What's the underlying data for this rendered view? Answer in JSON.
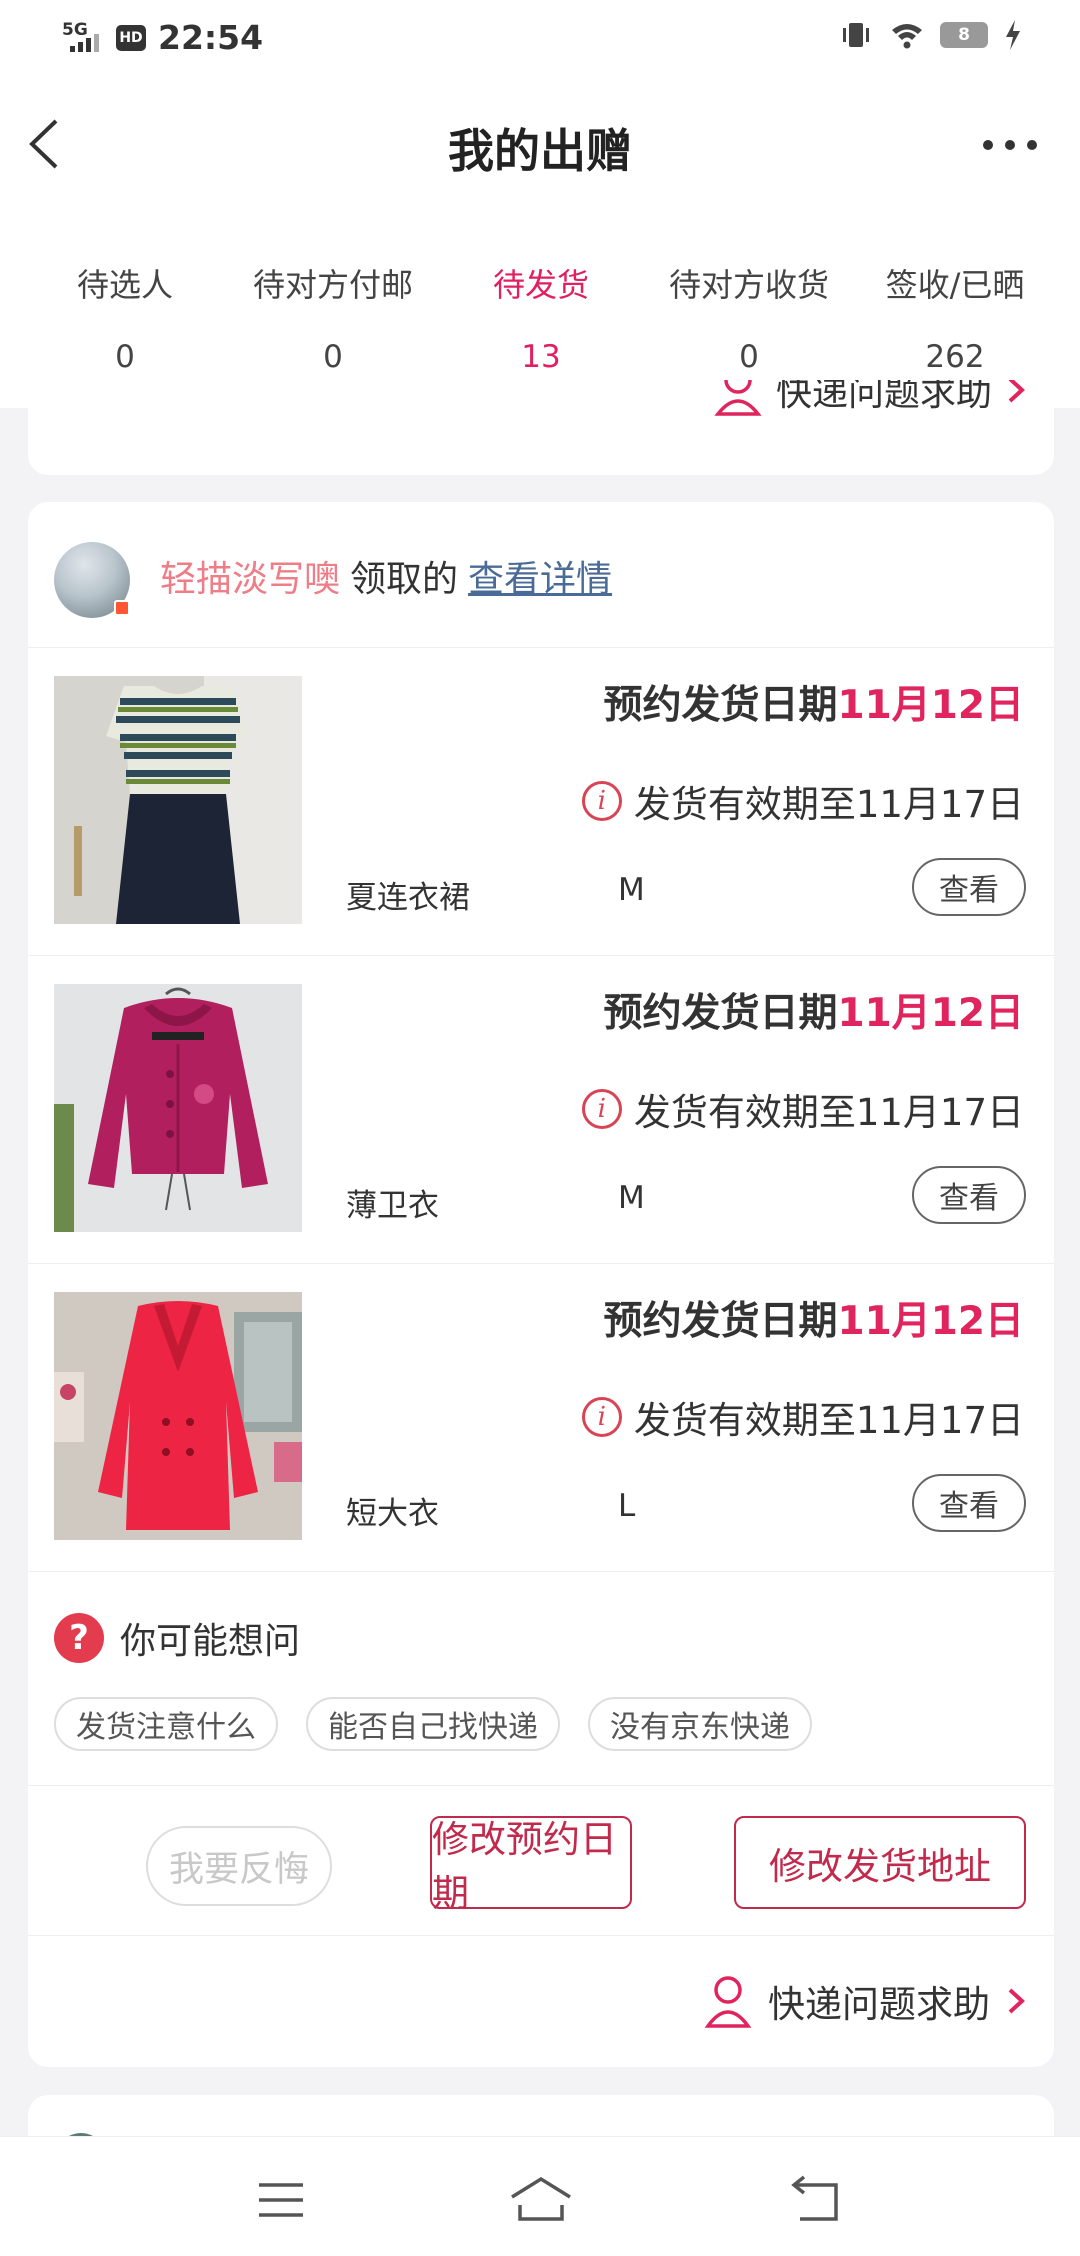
{
  "status_bar": {
    "network": "5G",
    "hd": "HD",
    "time": "22:54",
    "battery": "8"
  },
  "header": {
    "title": "我的出赠"
  },
  "tabs": [
    {
      "label": "待选人",
      "count": "0"
    },
    {
      "label": "待对方付邮",
      "count": "0"
    },
    {
      "label": "待发货",
      "count": "13"
    },
    {
      "label": "待对方收货",
      "count": "0"
    },
    {
      "label": "签收/已晒",
      "count": "262"
    }
  ],
  "prev_card": {
    "help_label": "快递问题求助"
  },
  "card": {
    "claimer_name": "轻描淡写噢",
    "claim_text": "领取的",
    "detail_link": "查看详情",
    "items": [
      {
        "date_prefix": "预约发货日期",
        "date": "11月12日",
        "valid": "发货有效期至11月17日",
        "name": "夏连衣裙",
        "size": "M",
        "view": "查看"
      },
      {
        "date_prefix": "预约发货日期",
        "date": "11月12日",
        "valid": "发货有效期至11月17日",
        "name": "薄卫衣",
        "size": "M",
        "view": "查看"
      },
      {
        "date_prefix": "预约发货日期",
        "date": "11月12日",
        "valid": "发货有效期至11月17日",
        "name": "短大衣",
        "size": "L",
        "view": "查看"
      }
    ],
    "faq": {
      "title": "你可能想问",
      "chips": [
        "发货注意什么",
        "能否自己找快递",
        "没有京东快递"
      ]
    },
    "actions": {
      "regret": "我要反悔",
      "change_date": "修改预约日期",
      "change_address": "修改发货地址"
    },
    "help_label": "快递问题求助"
  },
  "colors": {
    "accent": "#e0245e",
    "link": "#4a6b98",
    "button_border": "#c22a4c"
  }
}
